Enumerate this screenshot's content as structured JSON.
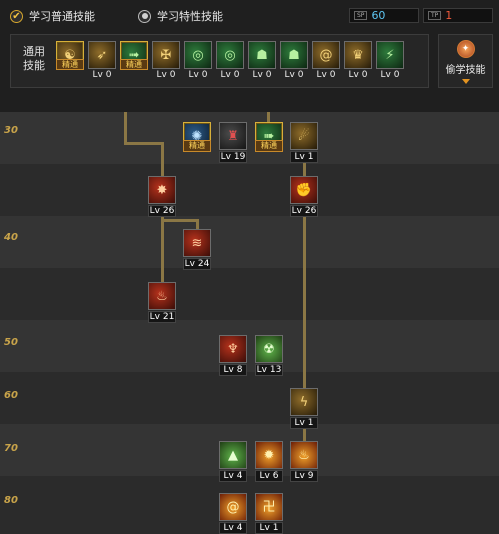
{
  "tabs": [
    {
      "label": "学习普通技能",
      "selected": true
    },
    {
      "label": "学习特性技能",
      "selected": false
    }
  ],
  "points": [
    {
      "tag": "SP",
      "value": "60",
      "color": "#5ec6f2"
    },
    {
      "tag": "TP",
      "value": "1",
      "color": "#f05a3c"
    }
  ],
  "common_skills": {
    "title": "通用技能",
    "items": [
      {
        "icon": "sit-meditate-icon",
        "label": "精通",
        "mastered": true,
        "theme": "gold"
      },
      {
        "icon": "leap-icon",
        "label": "Lv 0",
        "mastered": false,
        "theme": "gold"
      },
      {
        "icon": "dash-icon",
        "label": "精通",
        "mastered": true,
        "theme": "green"
      },
      {
        "icon": "wings-icon",
        "label": "Lv 0",
        "mastered": false,
        "theme": "gold"
      },
      {
        "icon": "target-icon",
        "label": "Lv 0",
        "mastered": false,
        "theme": "green"
      },
      {
        "icon": "target-icon",
        "label": "Lv 0",
        "mastered": false,
        "theme": "green"
      },
      {
        "icon": "figure-icon",
        "label": "Lv 0",
        "mastered": false,
        "theme": "green"
      },
      {
        "icon": "figure-icon",
        "label": "Lv 0",
        "mastered": false,
        "theme": "green"
      },
      {
        "icon": "swirl-icon",
        "label": "Lv 0",
        "mastered": false,
        "theme": "gold"
      },
      {
        "icon": "strongman-icon",
        "label": "Lv 0",
        "mastered": false,
        "theme": "gold"
      },
      {
        "icon": "kick-icon",
        "label": "Lv 0",
        "mastered": false,
        "theme": "green"
      }
    ]
  },
  "steal_button": {
    "label": "偷学技能",
    "icon": "steal-orb-icon"
  },
  "tree": {
    "levels": [
      "30",
      "40",
      "50",
      "60",
      "70",
      "80"
    ],
    "skills": [
      {
        "icon": "crystal-burst-icon",
        "label": "精通",
        "mastered": true,
        "theme": "blue"
      },
      {
        "icon": "armored-warrior-icon",
        "label": "Lv 19",
        "mastered": false,
        "theme": "dark"
      },
      {
        "icon": "runner-icon",
        "label": "精通",
        "mastered": true,
        "theme": "green"
      },
      {
        "icon": "ground-slam-icon",
        "label": "Lv 1",
        "mastered": false,
        "theme": "gold"
      },
      {
        "icon": "fire-kick-icon",
        "label": "Lv 26",
        "mastered": false,
        "theme": "red"
      },
      {
        "icon": "fire-fist-icon",
        "label": "Lv 26",
        "mastered": false,
        "theme": "red"
      },
      {
        "icon": "claw-slash-icon",
        "label": "Lv 24",
        "mastered": false,
        "theme": "red"
      },
      {
        "icon": "flame-dash-icon",
        "label": "Lv 21",
        "mastered": false,
        "theme": "red"
      },
      {
        "icon": "flame-spirit-icon",
        "label": "Lv 8",
        "mastered": false,
        "theme": "red"
      },
      {
        "icon": "green-demon-icon",
        "label": "Lv 13",
        "mastered": false,
        "theme": "greenfire"
      },
      {
        "icon": "lightning-strike-icon",
        "label": "Lv 1",
        "mastered": false,
        "theme": "gold"
      },
      {
        "icon": "fire-pillar-icon",
        "label": "Lv 4",
        "mastered": false,
        "theme": "greenfire"
      },
      {
        "icon": "flame-burst-icon",
        "label": "Lv 6",
        "mastered": false,
        "theme": "fire"
      },
      {
        "icon": "inferno-icon",
        "label": "Lv 9",
        "mastered": false,
        "theme": "fire"
      },
      {
        "icon": "fire-spiral-icon",
        "label": "Lv 4",
        "mastered": false,
        "theme": "fire"
      },
      {
        "icon": "fury-rune-icon",
        "label": "Lv 1",
        "mastered": false,
        "theme": "fire"
      }
    ]
  }
}
